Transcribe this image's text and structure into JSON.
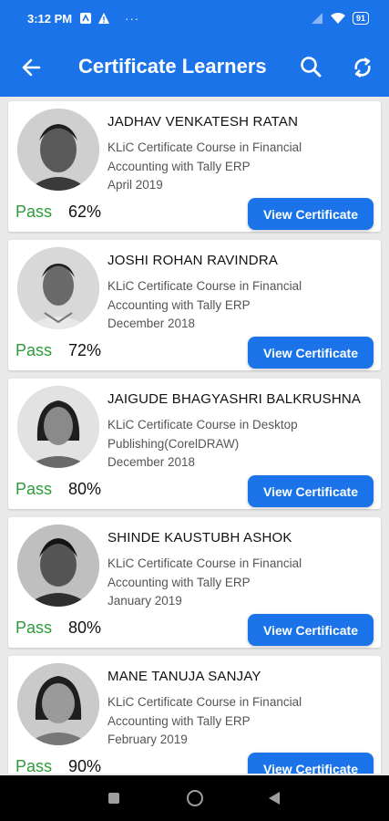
{
  "status_bar": {
    "time": "3:12 PM",
    "battery": "91"
  },
  "app_bar": {
    "title": "Certificate Learners"
  },
  "learners": [
    {
      "name": "JADHAV VENKATESH RATAN",
      "course": "KLiC Certificate Course in Financial Accounting with Tally ERP",
      "date": "April 2019",
      "status": "Pass",
      "percent": "62%",
      "button": "View Certificate"
    },
    {
      "name": "JOSHI ROHAN RAVINDRA",
      "course": "KLiC Certificate Course in Financial Accounting with Tally ERP",
      "date": "December 2018",
      "status": "Pass",
      "percent": "72%",
      "button": "View Certificate"
    },
    {
      "name": "JAIGUDE BHAGYASHRI BALKRUSHNA",
      "course": "KLiC Certificate Course in Desktop Publishing(CorelDRAW)",
      "date": "December 2018",
      "status": "Pass",
      "percent": "80%",
      "button": "View Certificate"
    },
    {
      "name": "SHINDE KAUSTUBH ASHOK",
      "course": "KLiC Certificate Course in Financial Accounting with Tally ERP",
      "date": "January 2019",
      "status": "Pass",
      "percent": "80%",
      "button": "View Certificate"
    },
    {
      "name": "MANE TANUJA SANJAY",
      "course": "KLiC Certificate Course in Financial Accounting with Tally ERP",
      "date": "February 2019",
      "status": "Pass",
      "percent": "90%",
      "button": "View Certificate"
    }
  ],
  "colors": {
    "primary": "#1a73e8",
    "pass": "#2e9b3a"
  }
}
